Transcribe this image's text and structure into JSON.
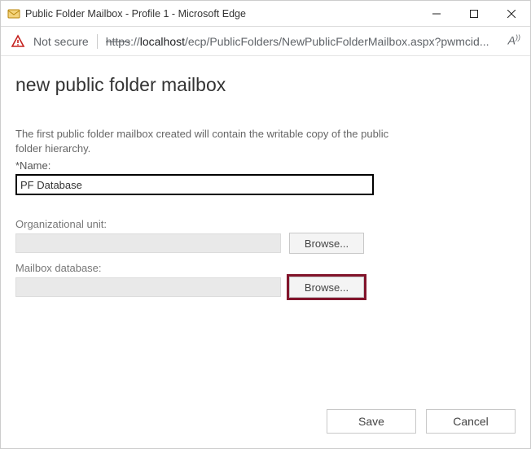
{
  "window": {
    "title": "Public Folder Mailbox - Profile 1 - Microsoft Edge"
  },
  "addrbar": {
    "not_secure": "Not secure",
    "proto": "https",
    "host": "localhost",
    "path": "/ecp/PublicFolders/NewPublicFolderMailbox.aspx?pwmcid...",
    "reader_label": "A"
  },
  "form": {
    "heading": "new public folder mailbox",
    "description": "The first public folder mailbox created will contain the writable copy of the public folder hierarchy.",
    "name_label": "*Name:",
    "name_value": "PF Database",
    "org_label": "Organizational unit:",
    "org_browse": "Browse...",
    "db_label": "Mailbox database:",
    "db_browse": "Browse..."
  },
  "footer": {
    "save": "Save",
    "cancel": "Cancel"
  }
}
